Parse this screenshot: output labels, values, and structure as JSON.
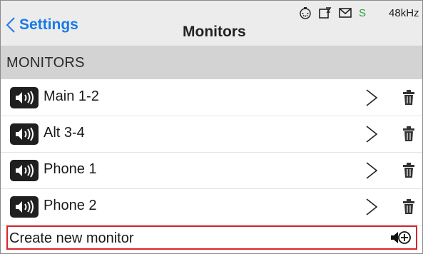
{
  "header": {
    "back_label": "Settings",
    "title": "Monitors",
    "status": {
      "icons": [
        "midi-icon",
        "usb-storage-icon",
        "mail-icon"
      ],
      "sync_label": "S",
      "sample_rate": "48kHz"
    }
  },
  "section": {
    "label": "MONITORS"
  },
  "monitors": [
    {
      "label": "Main 1-2"
    },
    {
      "label": "Alt 3-4"
    },
    {
      "label": "Phone 1"
    },
    {
      "label": "Phone 2"
    }
  ],
  "create": {
    "label": "Create new monitor",
    "highlight_color": "#d9252a"
  },
  "colors": {
    "accent": "#1a7ae6",
    "sync": "#22a33a",
    "header_bg": "#ececec",
    "section_bg": "#d3d3d3"
  }
}
